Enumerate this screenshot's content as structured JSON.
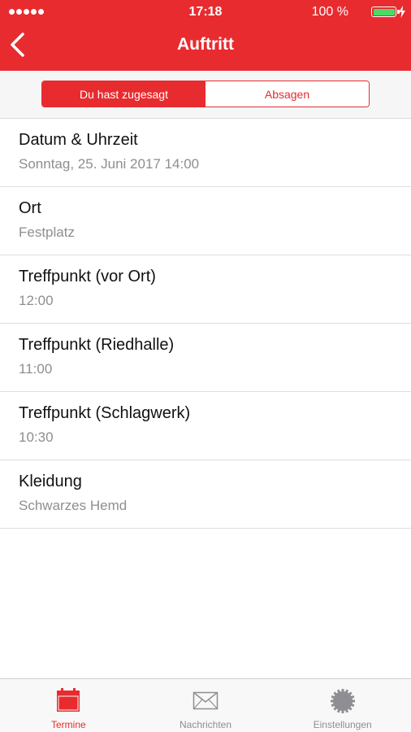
{
  "status_bar": {
    "time": "17:18",
    "battery_percent": "100 %",
    "battery_level": 1.0
  },
  "nav": {
    "title": "Auftritt",
    "back_icon": "chevron-left-icon"
  },
  "segmented": {
    "selected": "Du hast zugesagt",
    "options": [
      "Du hast zugesagt",
      "Absagen"
    ]
  },
  "details": [
    {
      "label": "Datum & Uhrzeit",
      "value": "Sonntag, 25. Juni 2017 14:00"
    },
    {
      "label": "Ort",
      "value": "Festplatz"
    },
    {
      "label": "Treffpunkt (vor Ort)",
      "value": "12:00"
    },
    {
      "label": "Treffpunkt (Riedhalle)",
      "value": "11:00"
    },
    {
      "label": "Treffpunkt (Schlagwerk)",
      "value": "10:30"
    },
    {
      "label": "Kleidung",
      "value": "Schwarzes Hemd"
    }
  ],
  "tabs": [
    {
      "label": "Termine",
      "icon": "calendar-icon",
      "active": true
    },
    {
      "label": "Nachrichten",
      "icon": "envelope-icon",
      "active": false
    },
    {
      "label": "Einstellungen",
      "icon": "gear-icon",
      "active": false
    }
  ],
  "colors": {
    "accent": "#e82b2f",
    "secondary_text": "#8e8e93",
    "battery": "#4cd964"
  }
}
